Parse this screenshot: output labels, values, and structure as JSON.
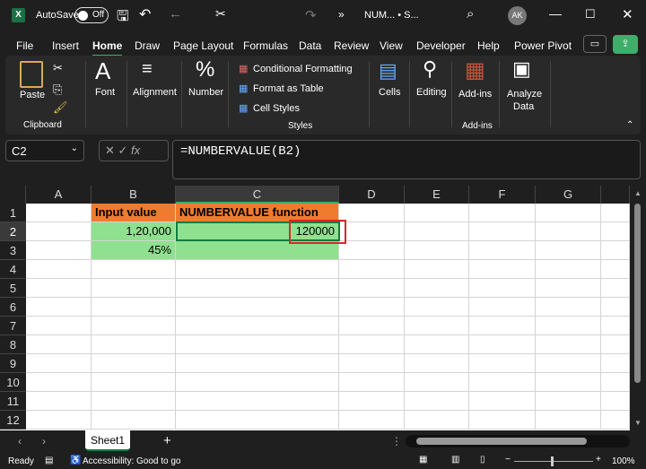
{
  "title": {
    "autosave": "AutoSave",
    "toggle": "Off",
    "filename": "NUM... • S...",
    "avatar": "AK"
  },
  "tabs": [
    "File",
    "Insert",
    "Home",
    "Draw",
    "Page Layout",
    "Formulas",
    "Data",
    "Review",
    "View",
    "Developer",
    "Help",
    "Power Pivot"
  ],
  "ribbon": {
    "paste": "Paste",
    "clipboard": "Clipboard",
    "font": "Font",
    "alignment": "Alignment",
    "number": "Number",
    "cond": "Conditional Formatting",
    "table": "Format as Table",
    "styles_btn": "Cell Styles",
    "styles": "Styles",
    "cells": "Cells",
    "editing": "Editing",
    "addins": "Add-ins",
    "addins_group": "Add-ins",
    "analyze1": "Analyze",
    "analyze2": "Data"
  },
  "formula_bar": {
    "name_box": "C2",
    "fx": "fx",
    "formula": "=NUMBERVALUE(B2)"
  },
  "columns": [
    "A",
    "B",
    "C",
    "D",
    "E",
    "F",
    "G"
  ],
  "rows": [
    "1",
    "2",
    "3",
    "4",
    "5",
    "6",
    "7",
    "8",
    "9",
    "10",
    "11",
    "12"
  ],
  "cells": {
    "B1": "Input value",
    "C1": "NUMBERVALUE function",
    "B2": "1,20,000",
    "C2": "120000",
    "B3": "45%"
  },
  "colors": {
    "header": "#f07b2f",
    "data": "#8fe08f",
    "selection": "#d9262c",
    "accent": "#3fae6a"
  },
  "sheet": {
    "name": "Sheet1"
  },
  "status": {
    "ready": "Ready",
    "accessibility": "Accessibility: Good to go",
    "zoom": "100%"
  }
}
